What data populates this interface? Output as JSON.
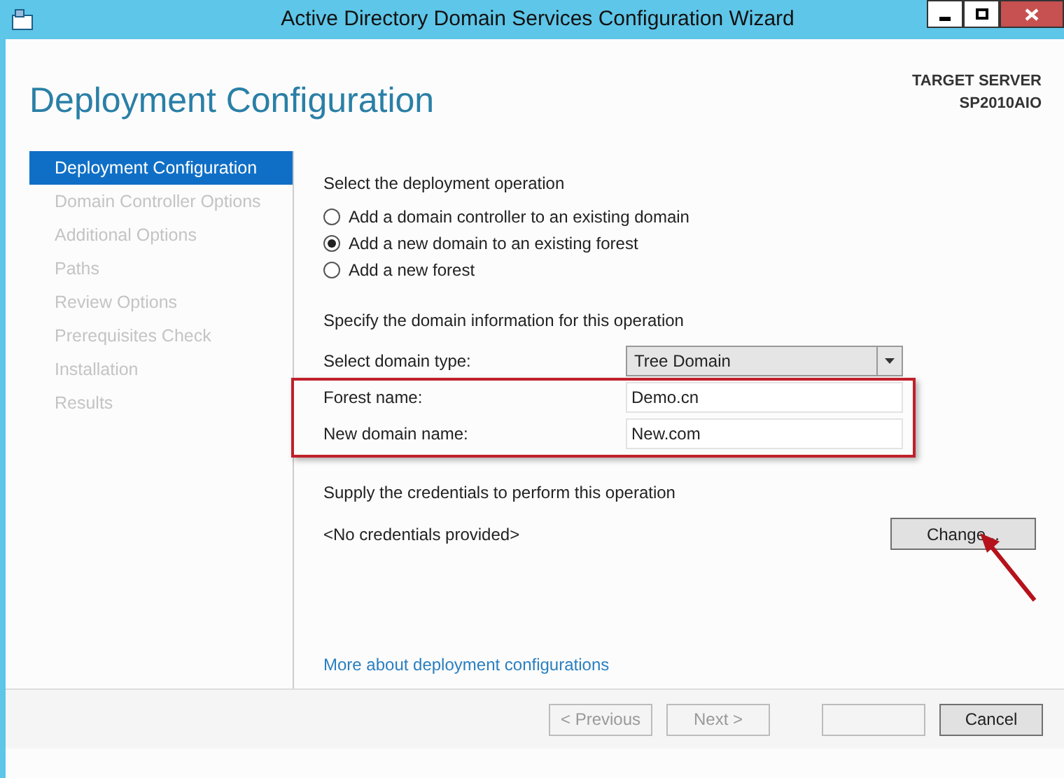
{
  "window": {
    "title": "Active Directory Domain Services Configuration Wizard"
  },
  "page_title": "Deployment Configuration",
  "target_server": {
    "label": "TARGET SERVER",
    "name": "SP2010AIO"
  },
  "sidebar": {
    "items": [
      {
        "label": "Deployment Configuration",
        "selected": true,
        "disabled": false
      },
      {
        "label": "Domain Controller Options",
        "selected": false,
        "disabled": true
      },
      {
        "label": "Additional Options",
        "selected": false,
        "disabled": true
      },
      {
        "label": "Paths",
        "selected": false,
        "disabled": true
      },
      {
        "label": "Review Options",
        "selected": false,
        "disabled": true
      },
      {
        "label": "Prerequisites Check",
        "selected": false,
        "disabled": true
      },
      {
        "label": "Installation",
        "selected": false,
        "disabled": true
      },
      {
        "label": "Results",
        "selected": false,
        "disabled": true
      }
    ]
  },
  "operation": {
    "heading": "Select the deployment operation",
    "options": [
      {
        "label": "Add a domain controller to an existing domain",
        "selected": false
      },
      {
        "label": "Add a new domain to an existing forest",
        "selected": true
      },
      {
        "label": "Add a new forest",
        "selected": false
      }
    ]
  },
  "domain_info": {
    "heading": "Specify the domain information for this operation",
    "fields": [
      {
        "kind": "select",
        "label": "Select domain type:",
        "value": "Tree Domain"
      },
      {
        "kind": "text",
        "label": "Forest name:",
        "value": "Demo.cn"
      },
      {
        "kind": "text",
        "label": "New domain name:",
        "value": "New.com"
      }
    ]
  },
  "credentials": {
    "heading": "Supply the credentials to perform this operation",
    "value": "<No credentials provided>",
    "button": "Change..."
  },
  "link": "More about deployment configurations",
  "buttons": [
    {
      "label": "< Previous",
      "disabled": true
    },
    {
      "label": "Next >",
      "disabled": true
    },
    {
      "disabled": true
    },
    {
      "label": "Cancel",
      "disabled": false
    }
  ]
}
